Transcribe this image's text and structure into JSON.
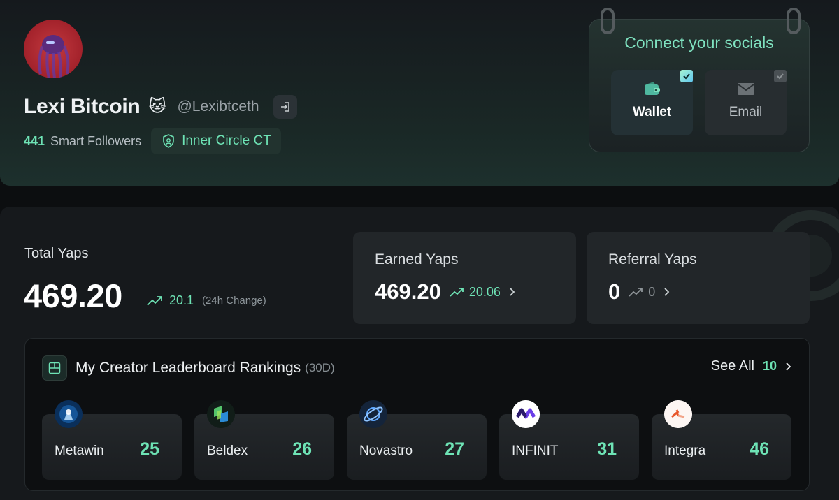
{
  "profile": {
    "display_name": "Lexi Bitcoin",
    "handle": "@Lexibtceth",
    "smart_followers_count": "441",
    "smart_followers_label": "Smart Followers",
    "badge_label": "Inner Circle CT"
  },
  "socials": {
    "title": "Connect your socials",
    "items": [
      {
        "label": "Wallet",
        "connected": true,
        "icon": "wallet-icon"
      },
      {
        "label": "Email",
        "connected": false,
        "icon": "mail-icon"
      }
    ]
  },
  "stats": {
    "total": {
      "label": "Total Yaps",
      "value": "469.20",
      "change": "20.1",
      "change_note": "(24h Change)"
    },
    "earned": {
      "label": "Earned Yaps",
      "value": "469.20",
      "change": "20.06"
    },
    "referral": {
      "label": "Referral Yaps",
      "value": "0",
      "change": "0"
    }
  },
  "leaderboard": {
    "title": "My Creator Leaderboard Rankings",
    "period": "(30D)",
    "see_all_label": "See All",
    "see_all_count": "10",
    "items": [
      {
        "name": "Metawin",
        "rank": "25"
      },
      {
        "name": "Beldex",
        "rank": "26"
      },
      {
        "name": "Novastro",
        "rank": "27"
      },
      {
        "name": "INFINIT",
        "rank": "31"
      },
      {
        "name": "Integra",
        "rank": "46"
      }
    ]
  },
  "colors": {
    "accent": "#6ee3b5",
    "background": "#0c0e10",
    "card": "#222629"
  }
}
